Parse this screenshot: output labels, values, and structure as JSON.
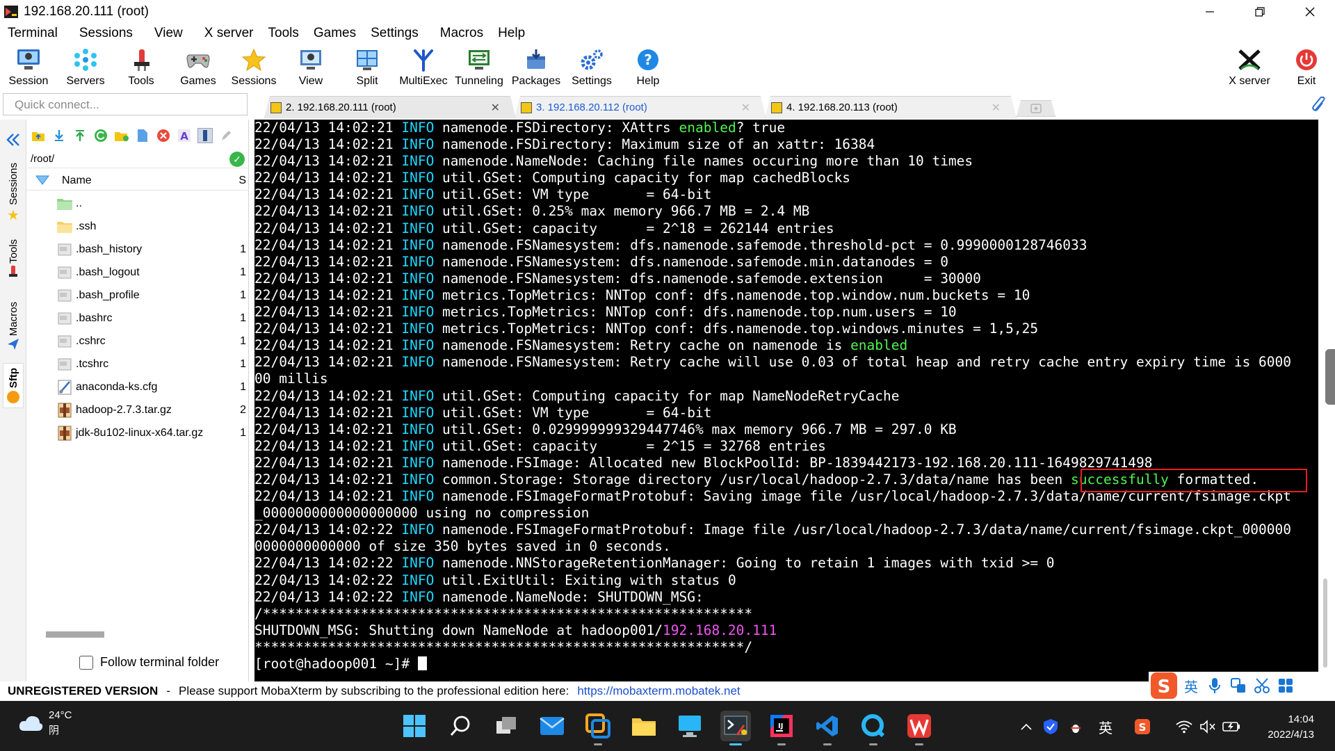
{
  "window": {
    "title": "192.168.20.111 (root)",
    "controls": [
      "minimize",
      "maximize",
      "close"
    ]
  },
  "menu": [
    "Terminal",
    "Sessions",
    "View",
    "X server",
    "Tools",
    "Games",
    "Settings",
    "Macros",
    "Help"
  ],
  "toolbar": {
    "left": [
      {
        "label": "Session",
        "icon": "session-icon"
      },
      {
        "label": "Servers",
        "icon": "servers-icon"
      },
      {
        "label": "Tools",
        "icon": "tools-icon"
      },
      {
        "label": "Games",
        "icon": "games-icon"
      },
      {
        "label": "Sessions",
        "icon": "star-icon"
      },
      {
        "label": "View",
        "icon": "view-icon"
      },
      {
        "label": "Split",
        "icon": "split-icon"
      },
      {
        "label": "MultiExec",
        "icon": "multiexec-icon"
      },
      {
        "label": "Tunneling",
        "icon": "tunneling-icon"
      },
      {
        "label": "Packages",
        "icon": "packages-icon"
      },
      {
        "label": "Settings",
        "icon": "settings-icon"
      },
      {
        "label": "Help",
        "icon": "help-icon"
      }
    ],
    "right": [
      {
        "label": "X server",
        "icon": "x-server-icon"
      },
      {
        "label": "Exit",
        "icon": "power-icon"
      }
    ]
  },
  "quick_connect": {
    "placeholder": "Quick connect..."
  },
  "tabs": [
    {
      "label": "2. 192.168.20.111 (root)",
      "active": true
    },
    {
      "label": "3. 192.168.20.112 (root)",
      "active": false
    },
    {
      "label": "4. 192.168.20.113 (root)",
      "active": false
    }
  ],
  "side_tabs": [
    "Sessions",
    "Tools",
    "Macros",
    "Sftp"
  ],
  "sftp": {
    "path": "/root/",
    "col_name": "Name",
    "col_size": "S",
    "files": [
      {
        "name": "..",
        "type": "folder-up",
        "size": ""
      },
      {
        "name": ".ssh",
        "type": "folder",
        "size": ""
      },
      {
        "name": ".bash_history",
        "type": "file",
        "size": "1"
      },
      {
        "name": ".bash_logout",
        "type": "file",
        "size": "1"
      },
      {
        "name": ".bash_profile",
        "type": "file",
        "size": "1"
      },
      {
        "name": ".bashrc",
        "type": "file",
        "size": "1"
      },
      {
        "name": ".cshrc",
        "type": "file",
        "size": "1"
      },
      {
        "name": ".tcshrc",
        "type": "file",
        "size": "1"
      },
      {
        "name": "anaconda-ks.cfg",
        "type": "cfg",
        "size": "1"
      },
      {
        "name": "hadoop-2.7.3.tar.gz",
        "type": "archive",
        "size": "2"
      },
      {
        "name": "jdk-8u102-linux-x64.tar.gz",
        "type": "archive",
        "size": "1"
      }
    ],
    "follow_label": "Follow terminal folder"
  },
  "terminal": {
    "lines": [
      {
        "ts": "22/04/13 14:02:21",
        "level": "INFO",
        "parts": [
          {
            "t": " namenode.FSDirectory: XAttrs "
          },
          {
            "t": "enabled",
            "c": "green"
          },
          {
            "t": "? true"
          }
        ]
      },
      {
        "ts": "22/04/13 14:02:21",
        "level": "INFO",
        "parts": [
          {
            "t": " namenode.FSDirectory: Maximum size of an xattr: 16384"
          }
        ]
      },
      {
        "ts": "22/04/13 14:02:21",
        "level": "INFO",
        "parts": [
          {
            "t": " namenode.NameNode: Caching file names occuring more than 10 times"
          }
        ]
      },
      {
        "ts": "22/04/13 14:02:21",
        "level": "INFO",
        "parts": [
          {
            "t": " util.GSet: Computing capacity for map cachedBlocks"
          }
        ]
      },
      {
        "ts": "22/04/13 14:02:21",
        "level": "INFO",
        "parts": [
          {
            "t": " util.GSet: VM type       = 64-bit"
          }
        ]
      },
      {
        "ts": "22/04/13 14:02:21",
        "level": "INFO",
        "parts": [
          {
            "t": " util.GSet: 0.25% max memory 966.7 MB = 2.4 MB"
          }
        ]
      },
      {
        "ts": "22/04/13 14:02:21",
        "level": "INFO",
        "parts": [
          {
            "t": " util.GSet: capacity      = 2^18 = 262144 entries"
          }
        ]
      },
      {
        "ts": "22/04/13 14:02:21",
        "level": "INFO",
        "parts": [
          {
            "t": " namenode.FSNamesystem: dfs.namenode.safemode.threshold-pct = 0.9990000128746033"
          }
        ]
      },
      {
        "ts": "22/04/13 14:02:21",
        "level": "INFO",
        "parts": [
          {
            "t": " namenode.FSNamesystem: dfs.namenode.safemode.min.datanodes = 0"
          }
        ]
      },
      {
        "ts": "22/04/13 14:02:21",
        "level": "INFO",
        "parts": [
          {
            "t": " namenode.FSNamesystem: dfs.namenode.safemode.extension     = 30000"
          }
        ]
      },
      {
        "ts": "22/04/13 14:02:21",
        "level": "INFO",
        "parts": [
          {
            "t": " metrics.TopMetrics: NNTop conf: dfs.namenode.top.window.num.buckets = 10"
          }
        ]
      },
      {
        "ts": "22/04/13 14:02:21",
        "level": "INFO",
        "parts": [
          {
            "t": " metrics.TopMetrics: NNTop conf: dfs.namenode.top.num.users = 10"
          }
        ]
      },
      {
        "ts": "22/04/13 14:02:21",
        "level": "INFO",
        "parts": [
          {
            "t": " metrics.TopMetrics: NNTop conf: dfs.namenode.top.windows.minutes = 1,5,25"
          }
        ]
      },
      {
        "ts": "22/04/13 14:02:21",
        "level": "INFO",
        "parts": [
          {
            "t": " namenode.FSNamesystem: Retry cache on namenode is "
          },
          {
            "t": "enabled",
            "c": "green"
          }
        ]
      },
      {
        "ts": "22/04/13 14:02:21",
        "level": "INFO",
        "parts": [
          {
            "t": " namenode.FSNamesystem: Retry cache will use 0.03 of total heap and retry cache entry expiry time is 6000"
          }
        ]
      },
      {
        "raw": "00 millis"
      },
      {
        "ts": "22/04/13 14:02:21",
        "level": "INFO",
        "parts": [
          {
            "t": " util.GSet: Computing capacity for map NameNodeRetryCache"
          }
        ]
      },
      {
        "ts": "22/04/13 14:02:21",
        "level": "INFO",
        "parts": [
          {
            "t": " util.GSet: VM type       = 64-bit"
          }
        ]
      },
      {
        "ts": "22/04/13 14:02:21",
        "level": "INFO",
        "parts": [
          {
            "t": " util.GSet: 0.029999999329447746% max memory 966.7 MB = 297.0 KB"
          }
        ]
      },
      {
        "ts": "22/04/13 14:02:21",
        "level": "INFO",
        "parts": [
          {
            "t": " util.GSet: capacity      = 2^15 = 32768 entries"
          }
        ]
      },
      {
        "ts": "22/04/13 14:02:21",
        "level": "INFO",
        "parts": [
          {
            "t": " namenode.FSImage: Allocated new BlockPoolId: BP-1839442173-192.168.20.111-1649829741498"
          }
        ]
      },
      {
        "ts": "22/04/13 14:02:21",
        "level": "INFO",
        "parts": [
          {
            "t": " common.Storage: Storage directory /usr/local/hadoop-2.7.3/data/name has been "
          },
          {
            "t": "successfully",
            "c": "green"
          },
          {
            "t": " formatted."
          }
        ]
      },
      {
        "ts": "22/04/13 14:02:21",
        "level": "INFO",
        "parts": [
          {
            "t": " namenode.FSImageFormatProtobuf: Saving image file /usr/local/hadoop-2.7.3/data/name/current/fsimage.ckpt"
          }
        ]
      },
      {
        "raw": "_0000000000000000000 using no compression"
      },
      {
        "ts": "22/04/13 14:02:22",
        "level": "INFO",
        "parts": [
          {
            "t": " namenode.FSImageFormatProtobuf: Image file /usr/local/hadoop-2.7.3/data/name/current/fsimage.ckpt_000000"
          }
        ]
      },
      {
        "raw": "0000000000000 of size 350 bytes saved in 0 seconds."
      },
      {
        "ts": "22/04/13 14:02:22",
        "level": "INFO",
        "parts": [
          {
            "t": " namenode.NNStorageRetentionManager: Going to retain 1 images with txid >= 0"
          }
        ]
      },
      {
        "ts": "22/04/13 14:02:22",
        "level": "INFO",
        "parts": [
          {
            "t": " util.ExitUtil: Exiting with status 0"
          }
        ]
      },
      {
        "ts": "22/04/13 14:02:22",
        "level": "INFO",
        "parts": [
          {
            "t": " namenode.NameNode: SHUTDOWN_MSG:"
          }
        ]
      },
      {
        "raw": "/************************************************************"
      },
      {
        "parts_raw": [
          {
            "t": "SHUTDOWN_MSG: Shutting down NameNode at hadoop001/"
          },
          {
            "t": "192.168.20.111",
            "c": "magenta"
          }
        ]
      },
      {
        "raw": "************************************************************/"
      },
      {
        "raw": "[root@hadoop001 ~]# ",
        "cursor": true
      }
    ]
  },
  "status": {
    "unregistered": "UNREGISTERED VERSION",
    "sep": "-",
    "support_text": "Please support MobaXterm by subscribing to the professional edition here:",
    "link": "https://mobaxterm.mobatek.net"
  },
  "ime": {
    "lang": "英"
  },
  "taskbar": {
    "weather_temp": "24°C",
    "weather_desc": "阴",
    "tray_lang": "英",
    "time": "14:04",
    "date": "2022/4/13"
  },
  "colors": {
    "info": "#1fd8ff",
    "enabled_green": "#50f550",
    "ip_magenta": "#f055f0",
    "highlight_box": "#e52020",
    "link": "#1a4fd0"
  }
}
